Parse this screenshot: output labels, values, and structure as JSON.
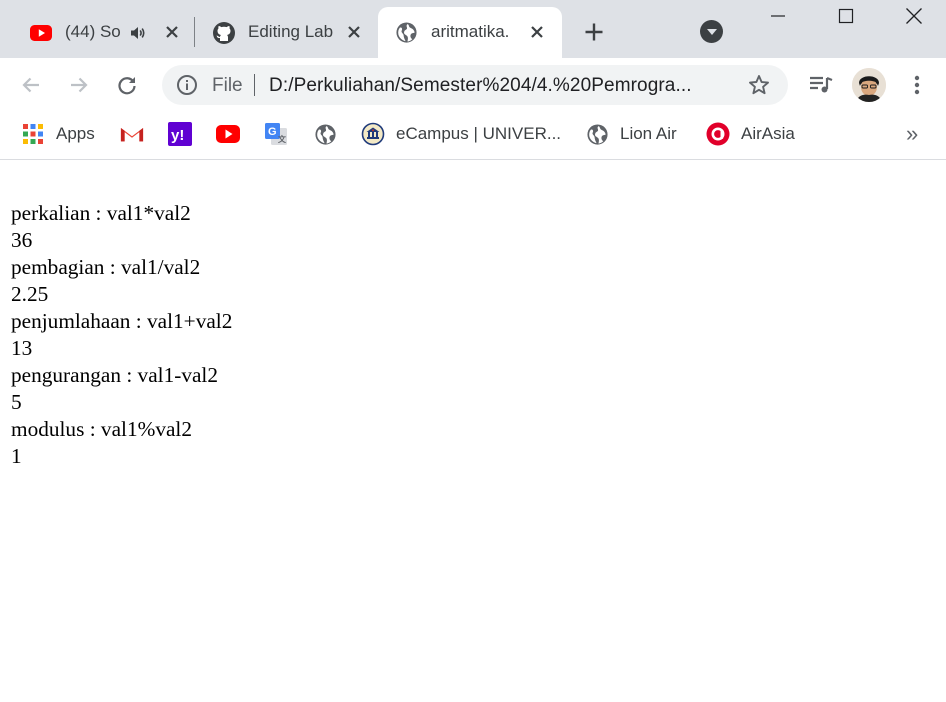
{
  "tabs": [
    {
      "label": "(44) So",
      "active": false
    },
    {
      "label": "Editing Lab",
      "active": false
    },
    {
      "label": "aritmatika.",
      "active": true
    }
  ],
  "omnibox": {
    "scheme_label": "File",
    "url": "D:/Perkuliahan/Semester%204/4.%20Pemrogra..."
  },
  "bookmarks": {
    "apps": "Apps",
    "ecampus": "eCampus | UNIVER...",
    "lionair": "Lion Air",
    "airasia": "AirAsia",
    "more": "»"
  },
  "page": {
    "lines": [
      "perkalian : val1*val2",
      "36",
      "pembagian : val1/val2",
      "2.25",
      "penjumlahaan : val1+val2",
      "13",
      "pengurangan : val1-val2",
      "5",
      "modulus : val1%val2",
      "1"
    ]
  },
  "colors": {
    "tabstrip": "#dee1e6",
    "youtube_red": "#ff0000",
    "airasia_red": "#e1002a",
    "yahoo_purple": "#6001d2"
  },
  "icons": {
    "tab1": "youtube-icon",
    "tab1_audio": "speaker-icon",
    "tab2": "github-icon",
    "tab3": "globe-icon"
  }
}
